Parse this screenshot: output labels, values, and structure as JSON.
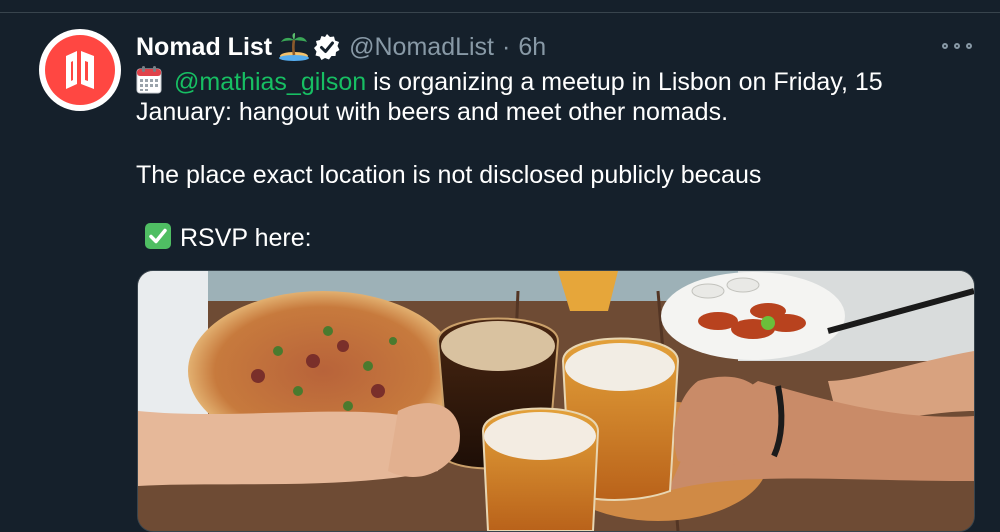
{
  "tweet": {
    "author_name": "Nomad List",
    "handle": "@NomadList",
    "separator": "·",
    "time": "6h",
    "mention": "@mathias_gilson",
    "line1_rest": " is organizing a meetup in Lisbon on Friday, 15",
    "line2": "January: hangout with beers and meet other nomads.",
    "line3": "The place exact location is not disclosed publicly becaus",
    "rsvp": "RSVP here:"
  },
  "icons": {
    "avatar": "nomad-list-logo",
    "name_emoji": "palm-tree-island-icon",
    "verified": "verified-badge-icon",
    "more": "more-options-icon",
    "calendar": "calendar-icon",
    "check": "check-mark-button-icon"
  },
  "colors": {
    "background": "#15202b",
    "text": "#ffffff",
    "muted": "#8899a6",
    "mention": "#17bf63",
    "brand": "#ff4742"
  }
}
